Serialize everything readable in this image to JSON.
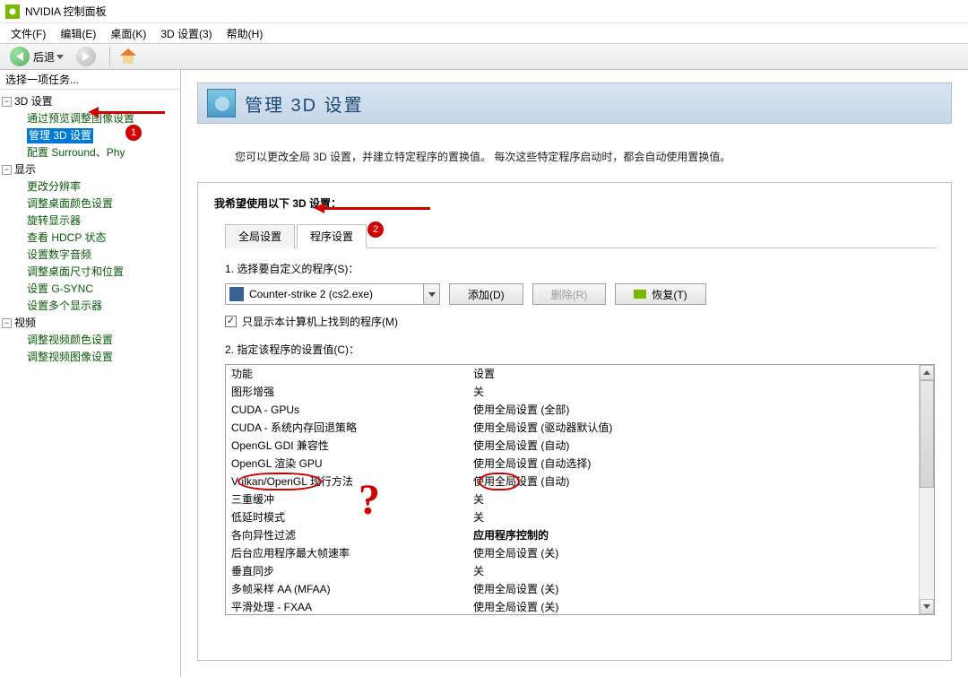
{
  "titlebar": {
    "text": "NVIDIA 控制面板"
  },
  "menubar": {
    "file": "文件(F)",
    "edit": "编辑(E)",
    "desktop": "桌面(K)",
    "settings3d": "3D 设置(3)",
    "help": "帮助(H)"
  },
  "toolbar": {
    "back": "后退"
  },
  "sidebar": {
    "header": "选择一项任务...",
    "g3d": "3D 设置",
    "g3d_items": {
      "preview": "通过预览调整图像设置",
      "manage": "管理 3D 设置",
      "surround": "配置 Surround、Phy"
    },
    "display": "显示",
    "display_items": {
      "res": "更改分辨率",
      "color": "调整桌面颜色设置",
      "rotate": "旋转显示器",
      "hdcp": "查看 HDCP 状态",
      "audio": "设置数字音频",
      "size": "调整桌面尺寸和位置",
      "gsync": "设置 G-SYNC",
      "multi": "设置多个显示器"
    },
    "video": "视频",
    "video_items": {
      "vcolor": "调整视频颜色设置",
      "vimage": "调整视频图像设置"
    }
  },
  "page": {
    "title": "管理 3D 设置",
    "desc": "您可以更改全局 3D 设置，并建立特定程序的置换值。 每次这些特定程序启动时，都会自动使用置换值。"
  },
  "panel": {
    "header": "我希望使用以下 3D 设置：",
    "tab_global": "全局设置",
    "tab_program": "程序设置",
    "step1": "1. 选择要自定义的程序(S)：",
    "program_selected": "Counter-strike 2 (cs2.exe)",
    "btn_add": "添加(D)",
    "btn_remove": "删除(R)",
    "btn_restore": "恢复(T)",
    "chk_local": "只显示本计算机上找到的程序(M)",
    "step2": "2. 指定该程序的设置值(C)：",
    "col_feature": "功能",
    "col_setting": "设置",
    "rows": [
      {
        "f": "图形增强",
        "s": "关"
      },
      {
        "f": "CUDA - GPUs",
        "s": "使用全局设置 (全部)"
      },
      {
        "f": "CUDA - 系统内存回退策略",
        "s": "使用全局设置 (驱动器默认值)"
      },
      {
        "f": "OpenGL GDI 兼容性",
        "s": "使用全局设置 (自动)"
      },
      {
        "f": "OpenGL 渲染 GPU",
        "s": "使用全局设置 (自动选择)"
      },
      {
        "f": "Vulkan/OpenGL 现行方法",
        "s": "使用全局设置 (自动)"
      },
      {
        "f": "三重缓冲",
        "s": "关"
      },
      {
        "f": "低延时模式",
        "s": "关"
      },
      {
        "f": "各向异性过滤",
        "s": "应用程序控制的",
        "bold": true
      },
      {
        "f": "后台应用程序最大帧速率",
        "s": "使用全局设置 (关)"
      },
      {
        "f": "垂直同步",
        "s": "关"
      },
      {
        "f": "多帧采样 AA (MFAA)",
        "s": "使用全局设置 (关)"
      },
      {
        "f": "平滑处理 - FXAA",
        "s": "使用全局设置 (关)"
      }
    ]
  },
  "annotations": {
    "badge1": "1",
    "badge2": "2",
    "q": "?"
  }
}
